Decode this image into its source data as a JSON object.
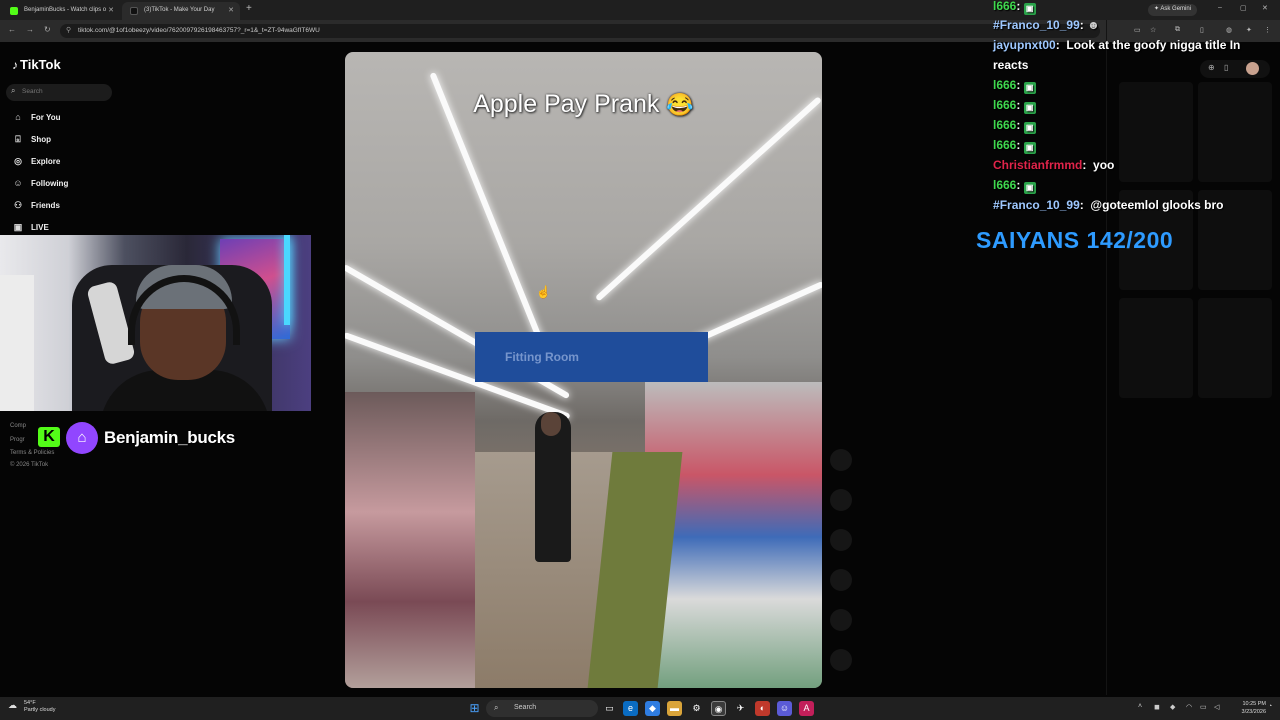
{
  "browser": {
    "tabs": [
      {
        "title": "BenjaminBucks - Watch clips o",
        "active": false
      },
      {
        "title": "(3)TikTok - Make Your Day",
        "active": true
      }
    ],
    "new_tab": "+",
    "ask_gemini": "Ask Gemini",
    "url": "tiktok.com/@1of1obeezy/video/7620097926198463757?_r=1&_t=ZT-94waGfIT6WU",
    "win_controls": {
      "minimize": "–",
      "maximize": "▢",
      "close": "✕"
    }
  },
  "tiktok": {
    "logo": "TikTok",
    "search_placeholder": "Search",
    "nav": [
      {
        "label": "For You",
        "icon": "home-icon"
      },
      {
        "label": "Shop",
        "icon": "shop-icon"
      },
      {
        "label": "Explore",
        "icon": "compass-icon"
      },
      {
        "label": "Following",
        "icon": "following-icon"
      },
      {
        "label": "Friends",
        "icon": "friends-icon"
      },
      {
        "label": "LIVE",
        "icon": "live-icon"
      }
    ],
    "footer": [
      "Comp",
      "Progr",
      "Terms & Policies",
      "© 2026 TikTok"
    ],
    "video_caption": "Apple Pay Prank",
    "video_caption_emoji": "😂",
    "store_sign": "Fitting Room"
  },
  "streamer": {
    "twitch_name": "Benjamin_bucks",
    "kick_letter": "K"
  },
  "chat": {
    "messages": [
      {
        "user": "l666",
        "text": "",
        "badge": true,
        "color": "#3fd84e"
      },
      {
        "user": "Franco_10_99",
        "text": "",
        "emote": true,
        "color": "#9ec8ff"
      },
      {
        "user": "jayupnxt00",
        "text": "Look at the goofy nigga title In reacts",
        "color": "#9ec8ff"
      },
      {
        "user": "l666",
        "text": "",
        "badge": true,
        "color": "#3fd84e"
      },
      {
        "user": "l666",
        "text": "",
        "badge": true,
        "color": "#3fd84e"
      },
      {
        "user": "l666",
        "text": "",
        "badge": true,
        "color": "#3fd84e"
      },
      {
        "user": "l666",
        "text": "",
        "badge": true,
        "color": "#3fd84e"
      },
      {
        "user": "Christianfrmmd",
        "text": "yoo",
        "color": "#e0244a"
      },
      {
        "user": "l666",
        "text": "",
        "badge": true,
        "color": "#3fd84e"
      },
      {
        "user": "Franco_10_99",
        "text": "@goteemlol glooks bro",
        "color": "#9ec8ff"
      }
    ],
    "saiyans_label": "SAIYANS 142/200"
  },
  "taskbar": {
    "weather_temp": "54°F",
    "weather_desc": "Partly cloudy",
    "search_label": "Search",
    "time": "10:25 PM",
    "date": "3/23/2026"
  },
  "colors": {
    "twitch": "#9146ff",
    "kick": "#53fc18",
    "saiyans": "#2e9bff",
    "sign": "#1f4d9b"
  }
}
